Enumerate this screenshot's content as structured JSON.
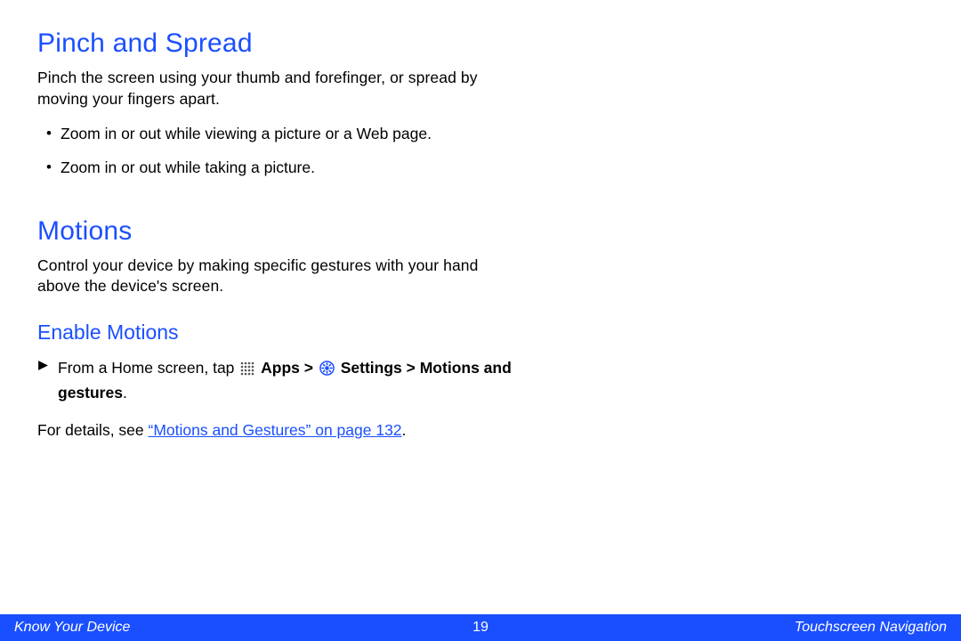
{
  "sections": {
    "pinch": {
      "title": "Pinch and Spread",
      "intro": "Pinch the screen using your thumb and forefinger, or spread by moving your fingers apart.",
      "bullets": [
        "Zoom in or out while viewing a picture or a Web page.",
        "Zoom in or out while taking a picture."
      ]
    },
    "motions": {
      "title": "Motions",
      "intro": "Control your device by making specific gestures with your hand above the device's screen.",
      "enable_title": "Enable Motions",
      "step_pre": "From a Home screen, tap ",
      "step_apps": "Apps",
      "step_gt1": " > ",
      "step_settings": "Settings",
      "step_gt2": " > ",
      "step_motions": "Motions and gestures",
      "step_period": ".",
      "details_pre": "For details, see ",
      "details_link": "“Motions and Gestures” on page 132",
      "details_post": "."
    }
  },
  "footer": {
    "left": "Know Your Device",
    "page": "19",
    "right": "Touchscreen Navigation"
  }
}
